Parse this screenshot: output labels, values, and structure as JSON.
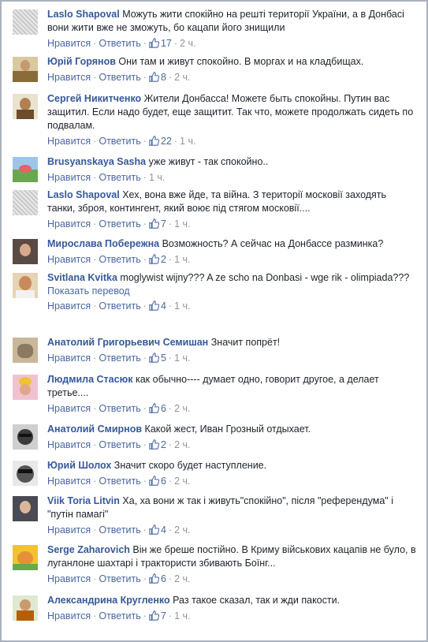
{
  "ui": {
    "like_label": "Нравится",
    "reply_label": "Ответить"
  },
  "comments": [
    {
      "author": "Laslo Shapoval",
      "text": "Можуть жити спокійно на решті території України, а в Донбасі вони жити вже не зможуть, бо кацапи його знищили",
      "likes": "17",
      "time": "2 ч."
    },
    {
      "author": "Юрій Горянов",
      "text": "Они там и живут спокойно. В моргах и на кладбищах.",
      "likes": "8",
      "time": "2 ч."
    },
    {
      "author": "Сергей Никитченко",
      "text": "Жители Донбасса! Можете быть спокойны. Путин вас защитил. Если надо будет, еще защитит. Так что, можете продолжать сидеть по подвалам.",
      "likes": "22",
      "time": "1 ч."
    },
    {
      "author": "Brusyanskaya Sasha",
      "text": "уже живут - так спокойно..",
      "likes": "",
      "time": "1 ч."
    },
    {
      "author": "Laslo Shapoval",
      "text": "Хех, вона вже йде, та війна. З території московії заходять танки, зброя, контингент, який воює під стягом московії....",
      "likes": "7",
      "time": "1 ч."
    },
    {
      "author": "Мирослава Побережна",
      "text": "Возможность? А сейчас на Донбассе разминка?",
      "likes": "2",
      "time": "1 ч."
    },
    {
      "author": "Svitlana Kvitka",
      "text": "moglywist wijny??? A ze scho na Donbasi - wge rik - olimpiada???",
      "translate": "Показать перевод",
      "likes": "4",
      "time": "1 ч."
    },
    {
      "author": "Анатолий Григорьевич Семишан",
      "text": "Значит попрёт!",
      "likes": "5",
      "time": "1 ч."
    },
    {
      "author": "Людмила Стасюк",
      "text": "как обычно---- думает одно, говорит другое, а делает третье....",
      "likes": "6",
      "time": "2 ч."
    },
    {
      "author": "Анатолий Смирнов",
      "text": "Какой жест, Иван Грозный отдыхает.",
      "likes": "2",
      "time": "2 ч."
    },
    {
      "author": "Юрий Шолох",
      "text": "Значит скоро будет наступление.",
      "likes": "6",
      "time": "2 ч."
    },
    {
      "author": "Viik Toria Litvin",
      "text": "Ха, ха вони ж так і живуть\"спокійно\", після \"референдума\" і \"путін памагі\"",
      "likes": "4",
      "time": "2 ч."
    },
    {
      "author": "Serge Zaharovich",
      "text": "Він же бреше постійно. В Криму військових кацапів не було, в луганлоне шахтарі і трактористи збивають Боїнг...",
      "likes": "6",
      "time": "2 ч."
    },
    {
      "author": "Александрина Кругленко",
      "text": "Раз такое сказал, так и жди пакости.",
      "likes": "7",
      "time": "1 ч."
    }
  ],
  "colors": {
    "author": "#365899",
    "link": "#4b67a1",
    "meta": "#90949c",
    "text": "#1d2129",
    "border": "#a9b1bd"
  }
}
